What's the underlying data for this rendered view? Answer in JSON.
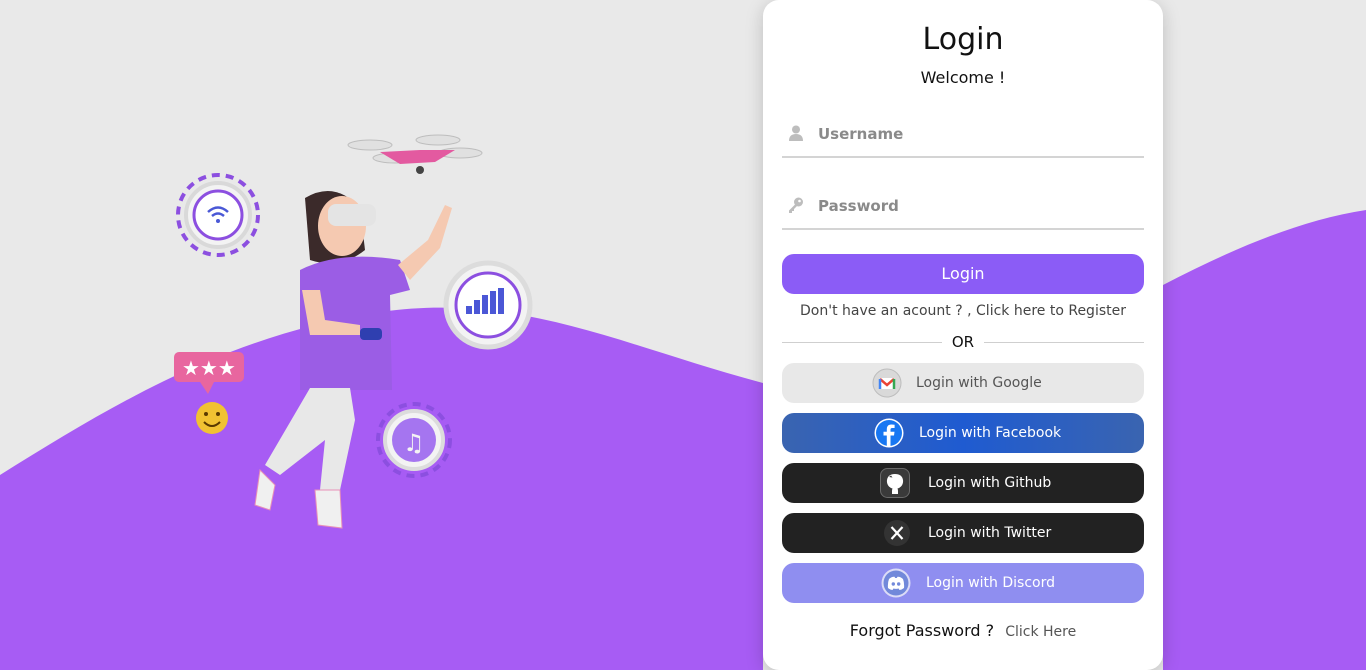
{
  "colors": {
    "background": "#e9e9e9",
    "wave": "#a75cf4",
    "accent": "#8b5cf6",
    "google_bg": "#e8e8e8",
    "facebook_bg": "#2f62b8",
    "github_bg": "#222222",
    "twitter_bg": "#222222",
    "discord_bg": "#8f8ef0"
  },
  "illustration": {
    "icons": [
      "wifi-icon",
      "chart-icon",
      "music-note-icon",
      "star-rating-icon",
      "smiley-icon",
      "drone-icon"
    ]
  },
  "card": {
    "title": "Login",
    "subtitle": "Welcome !",
    "username": {
      "placeholder": "Username",
      "value": "",
      "icon": "user-icon"
    },
    "password": {
      "placeholder": "Password",
      "value": "",
      "icon": "key-icon"
    },
    "login_button": "Login",
    "register_prefix": "Don't have an acount ? ,",
    "register_link": "Click here to Register",
    "or_text": "OR",
    "social": [
      {
        "label": "Login with Google",
        "icon": "gmail-icon"
      },
      {
        "label": "Login with Facebook",
        "icon": "facebook-icon"
      },
      {
        "label": "Login with Github",
        "icon": "github-icon"
      },
      {
        "label": "Login with Twitter",
        "icon": "x-twitter-icon"
      },
      {
        "label": "Login with Discord",
        "icon": "discord-icon"
      }
    ],
    "forgot_question": "Forgot Password ?",
    "forgot_link": "Click Here"
  }
}
